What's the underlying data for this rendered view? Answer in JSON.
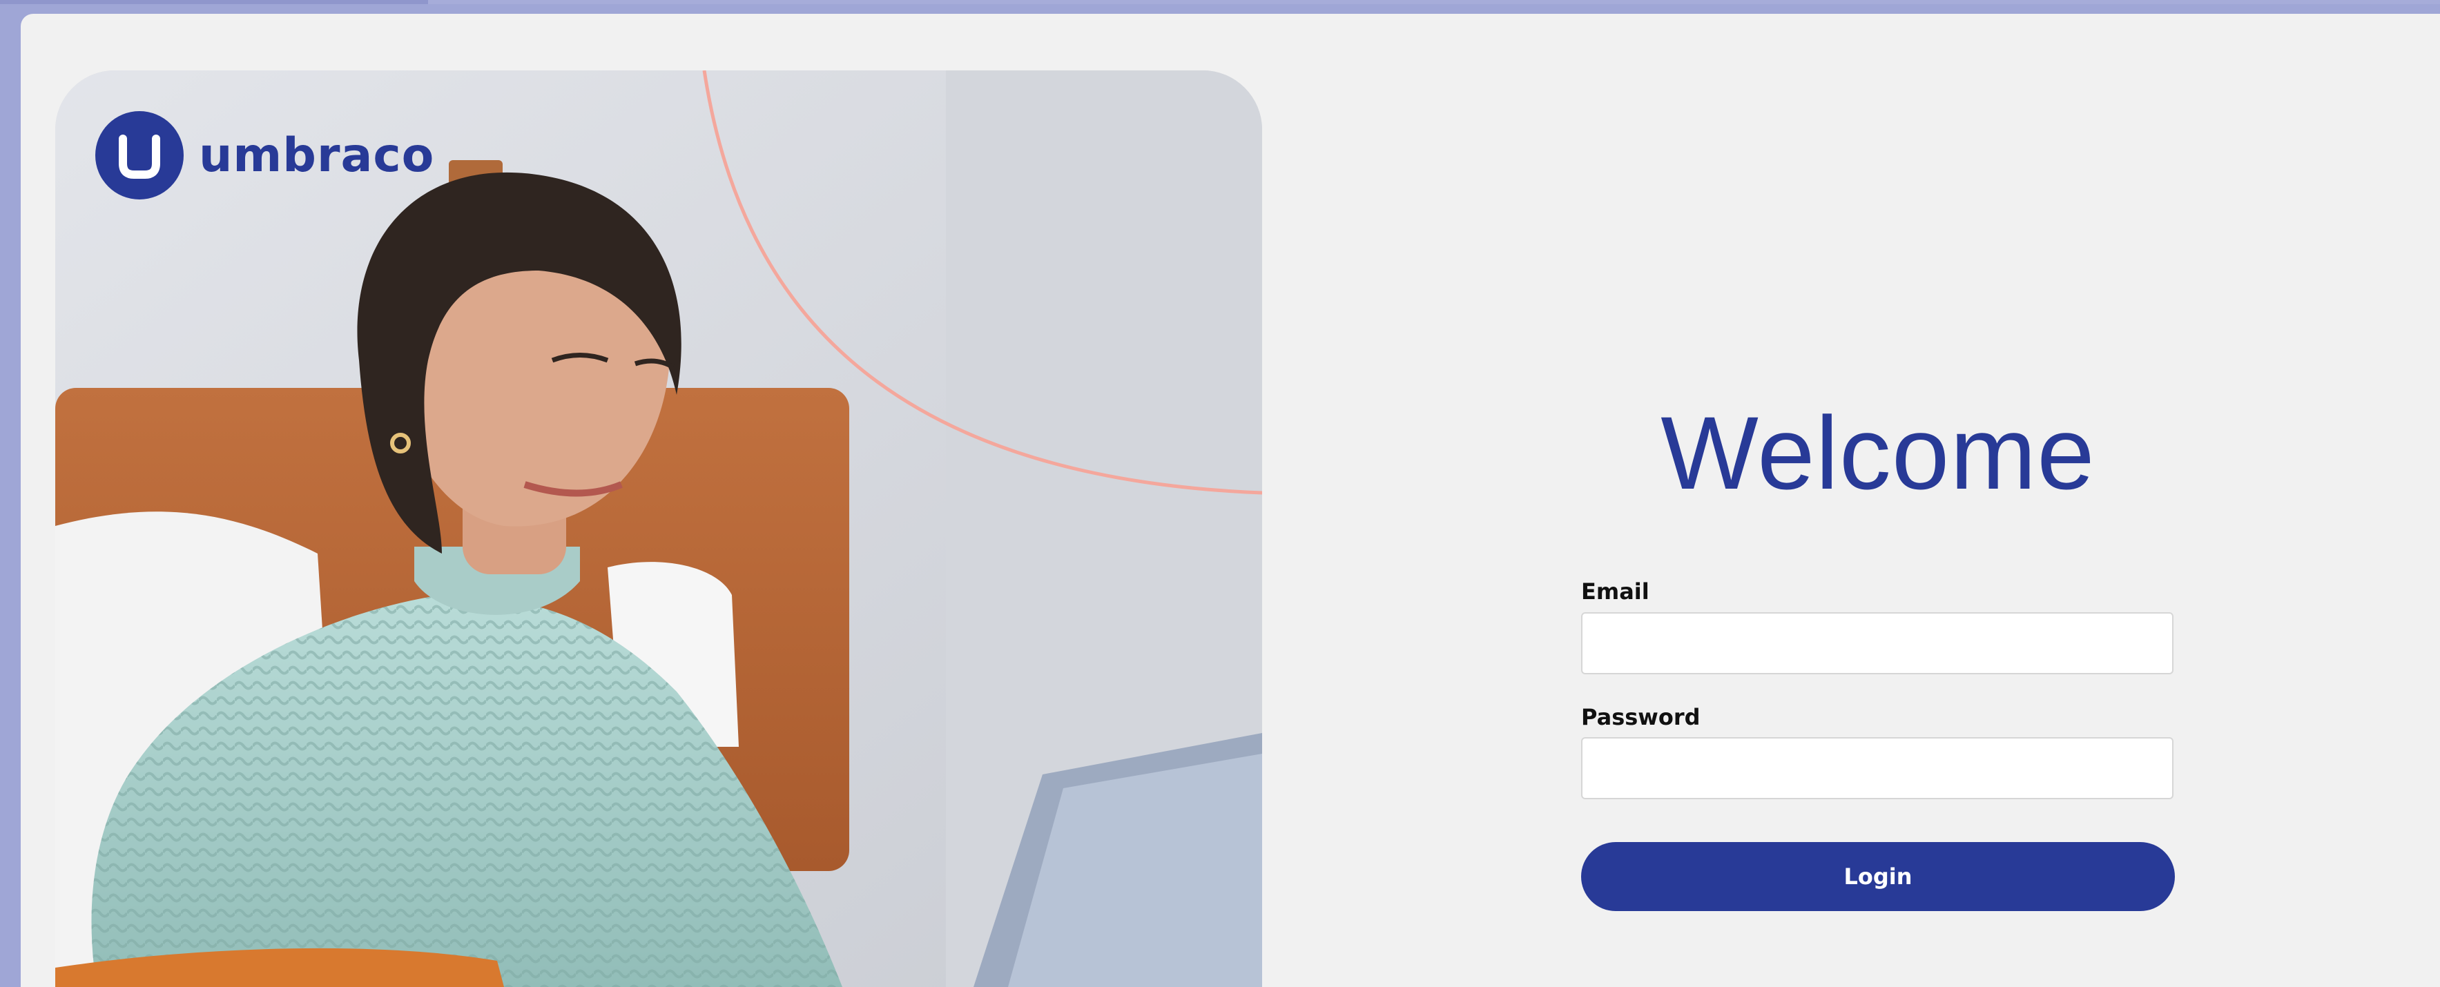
{
  "brand": {
    "logo_icon": "umbraco-u-logo-icon",
    "name": "umbraco",
    "color": "#283a97"
  },
  "hero": {
    "image": "woman-with-laptop-photo",
    "accent_curve_color": "#f4a79c"
  },
  "login": {
    "title": "Welcome",
    "email_label": "Email",
    "email_value": "",
    "password_label": "Password",
    "password_value": "",
    "submit_label": "Login"
  },
  "colors": {
    "primary": "#283a97",
    "page_background": "#f1f1f1",
    "outer_background": "#9fa6d6"
  }
}
